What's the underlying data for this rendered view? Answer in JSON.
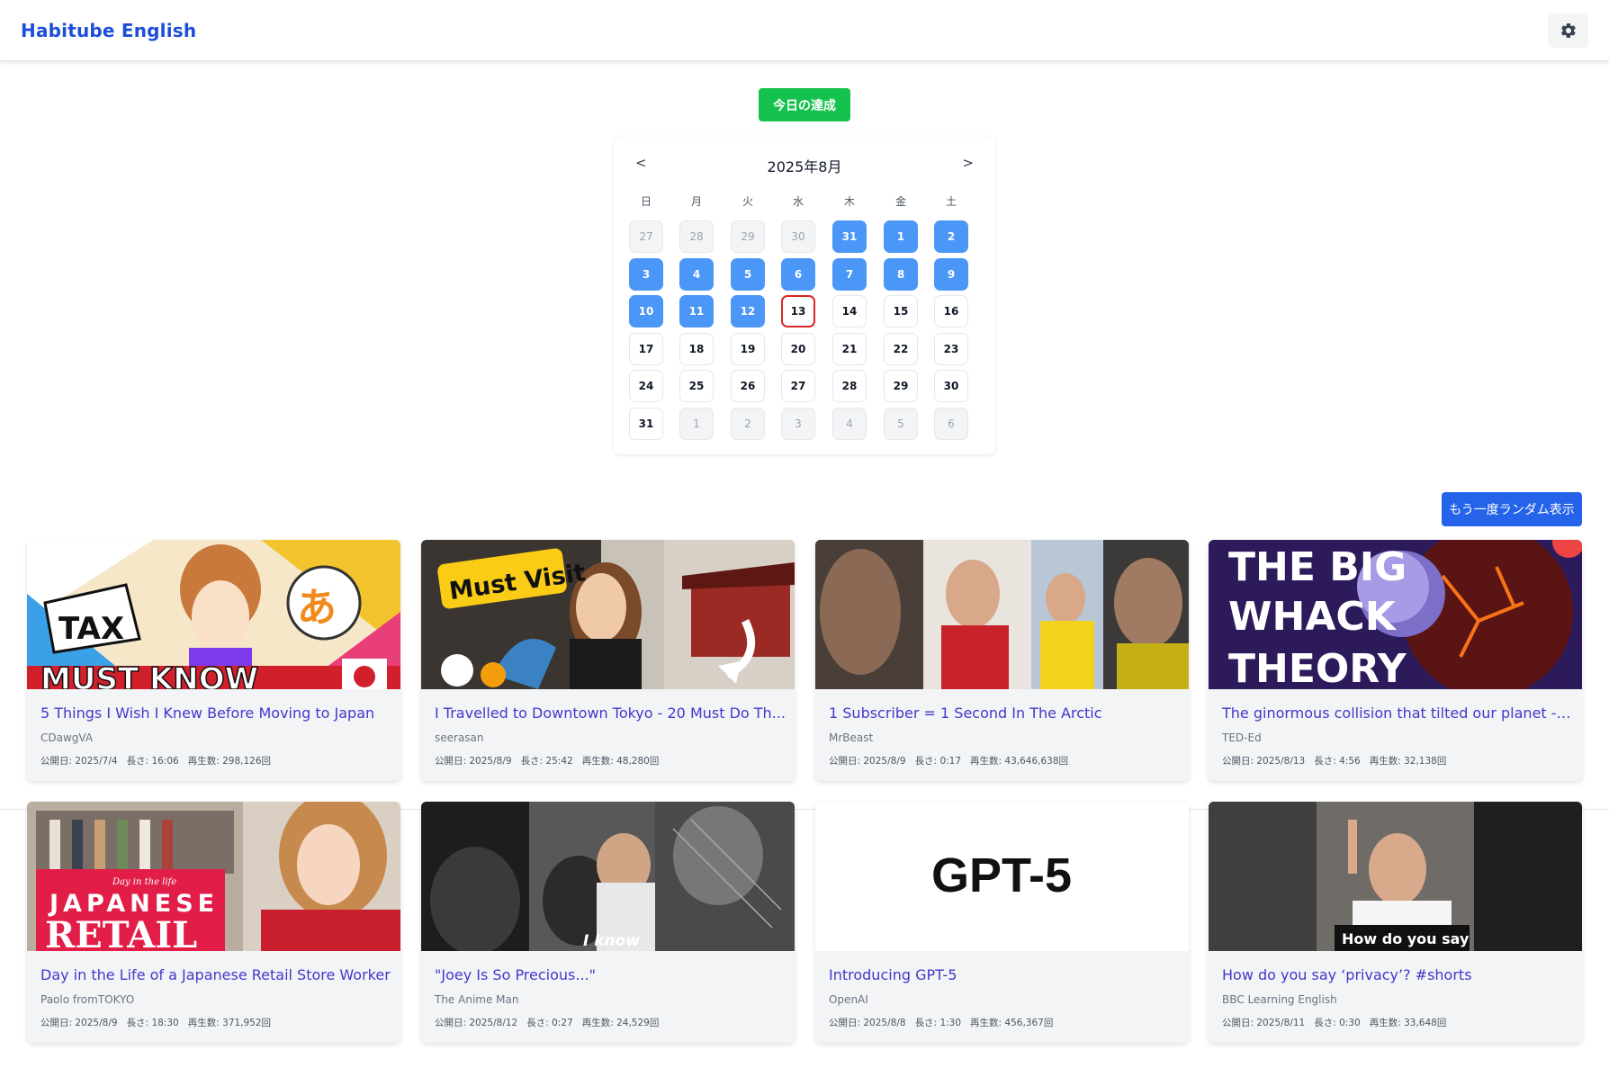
{
  "header": {
    "brand": "Habitube English",
    "settings_icon": "gear-icon"
  },
  "achievement": {
    "label": "今日の達成",
    "color": "#16c24e"
  },
  "calendar": {
    "title": "2025年8月",
    "prev": "<",
    "next": ">",
    "weekdays": [
      "日",
      "月",
      "火",
      "水",
      "木",
      "金",
      "土"
    ],
    "weeks": [
      [
        {
          "d": "27",
          "s": "other"
        },
        {
          "d": "28",
          "s": "other"
        },
        {
          "d": "29",
          "s": "other"
        },
        {
          "d": "30",
          "s": "other"
        },
        {
          "d": "31",
          "s": "done"
        },
        {
          "d": "1",
          "s": "done"
        },
        {
          "d": "2",
          "s": "done"
        }
      ],
      [
        {
          "d": "3",
          "s": "done"
        },
        {
          "d": "4",
          "s": "done"
        },
        {
          "d": "5",
          "s": "done"
        },
        {
          "d": "6",
          "s": "done"
        },
        {
          "d": "7",
          "s": "done"
        },
        {
          "d": "8",
          "s": "done"
        },
        {
          "d": "9",
          "s": "done"
        }
      ],
      [
        {
          "d": "10",
          "s": "done"
        },
        {
          "d": "11",
          "s": "done"
        },
        {
          "d": "12",
          "s": "done"
        },
        {
          "d": "13",
          "s": "today"
        },
        {
          "d": "14",
          "s": "norm"
        },
        {
          "d": "15",
          "s": "norm"
        },
        {
          "d": "16",
          "s": "norm"
        }
      ],
      [
        {
          "d": "17",
          "s": "norm"
        },
        {
          "d": "18",
          "s": "norm"
        },
        {
          "d": "19",
          "s": "norm"
        },
        {
          "d": "20",
          "s": "norm"
        },
        {
          "d": "21",
          "s": "norm"
        },
        {
          "d": "22",
          "s": "norm"
        },
        {
          "d": "23",
          "s": "norm"
        }
      ],
      [
        {
          "d": "24",
          "s": "norm"
        },
        {
          "d": "25",
          "s": "norm"
        },
        {
          "d": "26",
          "s": "norm"
        },
        {
          "d": "27",
          "s": "norm"
        },
        {
          "d": "28",
          "s": "norm"
        },
        {
          "d": "29",
          "s": "norm"
        },
        {
          "d": "30",
          "s": "norm"
        }
      ],
      [
        {
          "d": "31",
          "s": "norm"
        },
        {
          "d": "1",
          "s": "other"
        },
        {
          "d": "2",
          "s": "other"
        },
        {
          "d": "3",
          "s": "other"
        },
        {
          "d": "4",
          "s": "other"
        },
        {
          "d": "5",
          "s": "other"
        },
        {
          "d": "6",
          "s": "other"
        }
      ]
    ],
    "colors": {
      "done": "#4a97f7",
      "today_border": "#dc2626"
    }
  },
  "random_button": {
    "label": "もう一度ランダム表示",
    "color": "#2563eb"
  },
  "videos": [
    {
      "title": "5 Things I Wish I Knew Before Moving to Japan",
      "channel": "CDawgVA",
      "published": "公開日: 2025/7/4",
      "length": "長さ: 16:06",
      "views": "再生数: 298,126回",
      "thumb_text": [
        "TAX",
        "MUST KNOW",
        "あ"
      ]
    },
    {
      "title": "I Travelled to Downtown Tokyo - 20 Must Do Th...",
      "channel": "seerasan",
      "published": "公開日: 2025/8/9",
      "length": "長さ: 25:42",
      "views": "再生数: 48,280回",
      "thumb_text": [
        "Must Visit"
      ]
    },
    {
      "title": "1 Subscriber = 1 Second In The Arctic",
      "channel": "MrBeast",
      "published": "公開日: 2025/8/9",
      "length": "長さ: 0:17",
      "views": "再生数: 43,646,638回",
      "thumb_text": []
    },
    {
      "title": "The ginormous collision that tilted our planet - ...",
      "channel": "TED-Ed",
      "published": "公開日: 2025/8/13",
      "length": "長さ: 4:56",
      "views": "再生数: 32,138回",
      "thumb_text": [
        "THE BIG",
        "WHACK",
        "THEORY"
      ]
    },
    {
      "title": "Day in the Life of a Japanese Retail Store Worker",
      "channel": "Paolo fromTOKYO",
      "published": "公開日: 2025/8/9",
      "length": "長さ: 18:30",
      "views": "再生数: 371,952回",
      "thumb_text": [
        "Day in the life",
        "JAPANESE",
        "RETAIL"
      ]
    },
    {
      "title": "\"Joey Is So Precious...\"",
      "channel": "The Anime Man",
      "published": "公開日: 2025/8/12",
      "length": "長さ: 0:27",
      "views": "再生数: 24,529回",
      "thumb_text": [
        "I know"
      ]
    },
    {
      "title": "Introducing GPT-5",
      "channel": "OpenAI",
      "published": "公開日: 2025/8/8",
      "length": "長さ: 1:30",
      "views": "再生数: 456,367回",
      "thumb_text": [
        "GPT-5"
      ]
    },
    {
      "title": "How do you say ‘privacy’? #shorts",
      "channel": "BBC Learning English",
      "published": "公開日: 2025/8/11",
      "length": "長さ: 0:30",
      "views": "再生数: 33,648回",
      "thumb_text": [
        "How do you say"
      ]
    }
  ]
}
